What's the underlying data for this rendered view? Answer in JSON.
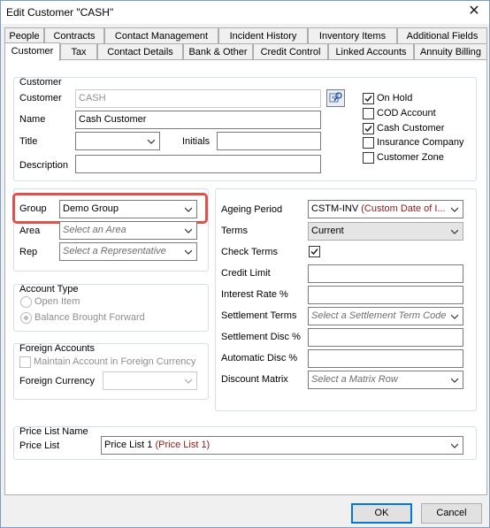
{
  "window": {
    "title": "Edit Customer \"CASH\"",
    "close_glyph": "✕"
  },
  "tabs_back": [
    {
      "label": "People"
    },
    {
      "label": "Contracts"
    },
    {
      "label": "Contact Management"
    },
    {
      "label": "Incident History"
    },
    {
      "label": "Inventory Items"
    },
    {
      "label": "Additional Fields"
    }
  ],
  "tabs_front": [
    {
      "label": "Customer",
      "active": true
    },
    {
      "label": "Tax"
    },
    {
      "label": "Contact Details"
    },
    {
      "label": "Bank & Other"
    },
    {
      "label": "Credit Control"
    },
    {
      "label": "Linked Accounts"
    },
    {
      "label": "Annuity Billing"
    }
  ],
  "customer": {
    "legend": "Customer",
    "customer_label": "Customer",
    "customer_value": "CASH",
    "name_label": "Name",
    "name_value": "Cash Customer",
    "title_label": "Title",
    "title_value": "",
    "initials_label": "Initials",
    "initials_value": "",
    "description_label": "Description",
    "description_value": "",
    "lookup_icon": "search-lookup-icon",
    "flags": [
      {
        "label": "On Hold",
        "checked": true
      },
      {
        "label": "COD Account",
        "checked": false
      },
      {
        "label": "Cash Customer",
        "checked": true
      },
      {
        "label": "Insurance Company",
        "checked": false
      },
      {
        "label": "Customer Zone",
        "checked": false
      }
    ]
  },
  "classification": {
    "group_label": "Group",
    "group_value": "Demo Group",
    "area_label": "Area",
    "area_placeholder": "Select an Area",
    "rep_label": "Rep",
    "rep_placeholder": "Select a Representative"
  },
  "account_type": {
    "legend": "Account Type",
    "open_item": "Open Item",
    "balance_bf": "Balance Brought Forward",
    "selected": "Balance Brought Forward"
  },
  "foreign": {
    "legend": "Foreign Accounts",
    "maintain_label": "Maintain Account in Foreign Currency",
    "currency_label": "Foreign Currency",
    "currency_value": ""
  },
  "terms": {
    "ageing_label": "Ageing Period",
    "ageing_code": "CSTM-INV",
    "ageing_desc": "(Custom Date of I...",
    "terms_label": "Terms",
    "terms_value": "Current",
    "check_terms_label": "Check Terms",
    "check_terms_checked": true,
    "credit_limit_label": "Credit Limit",
    "credit_limit_value": "",
    "interest_label": "Interest Rate %",
    "interest_value": "",
    "settlement_terms_label": "Settlement Terms",
    "settlement_terms_placeholder": "Select a Settlement Term Code",
    "settlement_disc_label": "Settlement Disc %",
    "settlement_disc_value": "",
    "auto_disc_label": "Automatic Disc %",
    "auto_disc_value": "",
    "discount_matrix_label": "Discount Matrix",
    "discount_matrix_placeholder": "Select a Matrix Row"
  },
  "price_list": {
    "legend": "Price List Name",
    "label": "Price List",
    "value": "Price List 1",
    "value_desc": "(Price List 1)"
  },
  "buttons": {
    "ok": "OK",
    "cancel": "Cancel"
  },
  "colors": {
    "highlight": "#d9534f",
    "desc_text": "#8b1a1a",
    "default_button": "#0078d7"
  }
}
